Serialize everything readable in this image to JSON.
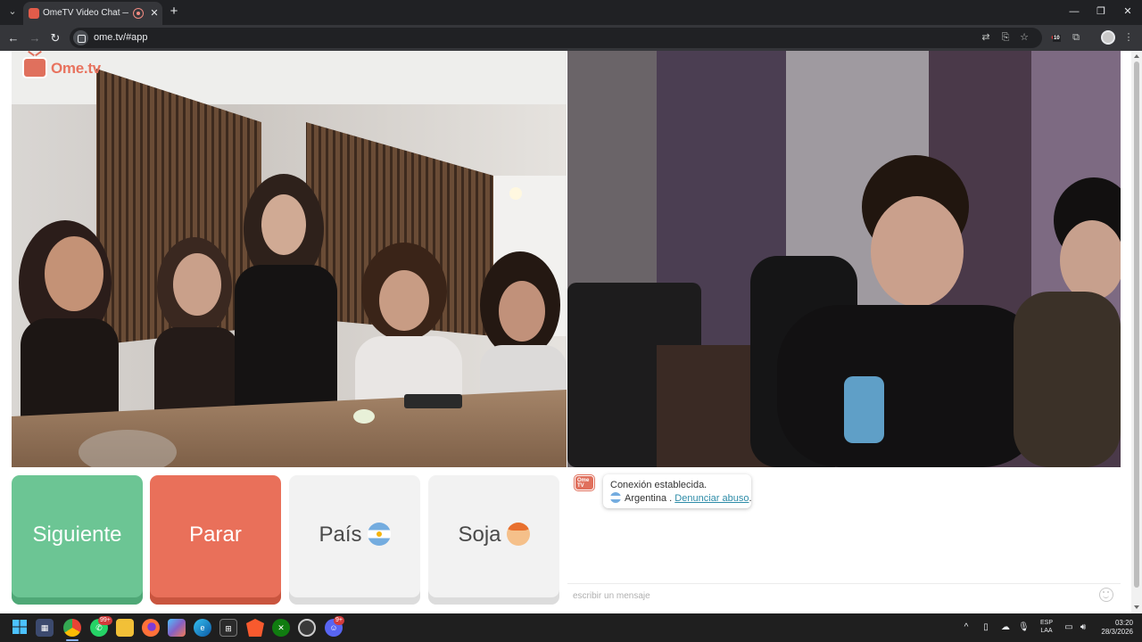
{
  "browser": {
    "tab_title": "OmeTV Video Chat — Alte",
    "url": "ome.tv/#app",
    "extension_badge": "10"
  },
  "app": {
    "logo_text": "Ome.tv",
    "logo_mini_text": "Ome TV",
    "buttons": {
      "next": "Siguiente",
      "stop": "Parar",
      "country": "País",
      "gender": "Soja"
    },
    "chat": {
      "status": "Conexión establecida.",
      "country": "Argentina",
      "separator": ".",
      "report_link": "Denunciar abuso",
      "report_suffix": ".",
      "input_placeholder": "escribir un mensaje"
    },
    "colors": {
      "next_green": "#6cc594",
      "stop_red": "#e9705a",
      "brand": "#e0705d",
      "link": "#2e8ca8"
    }
  },
  "taskbar": {
    "whatsapp_badge": "99+",
    "discord_badge": "9+",
    "lang_line1": "ESP",
    "lang_line2": "LAA",
    "time": "03:20",
    "date": "28/3/2026"
  }
}
